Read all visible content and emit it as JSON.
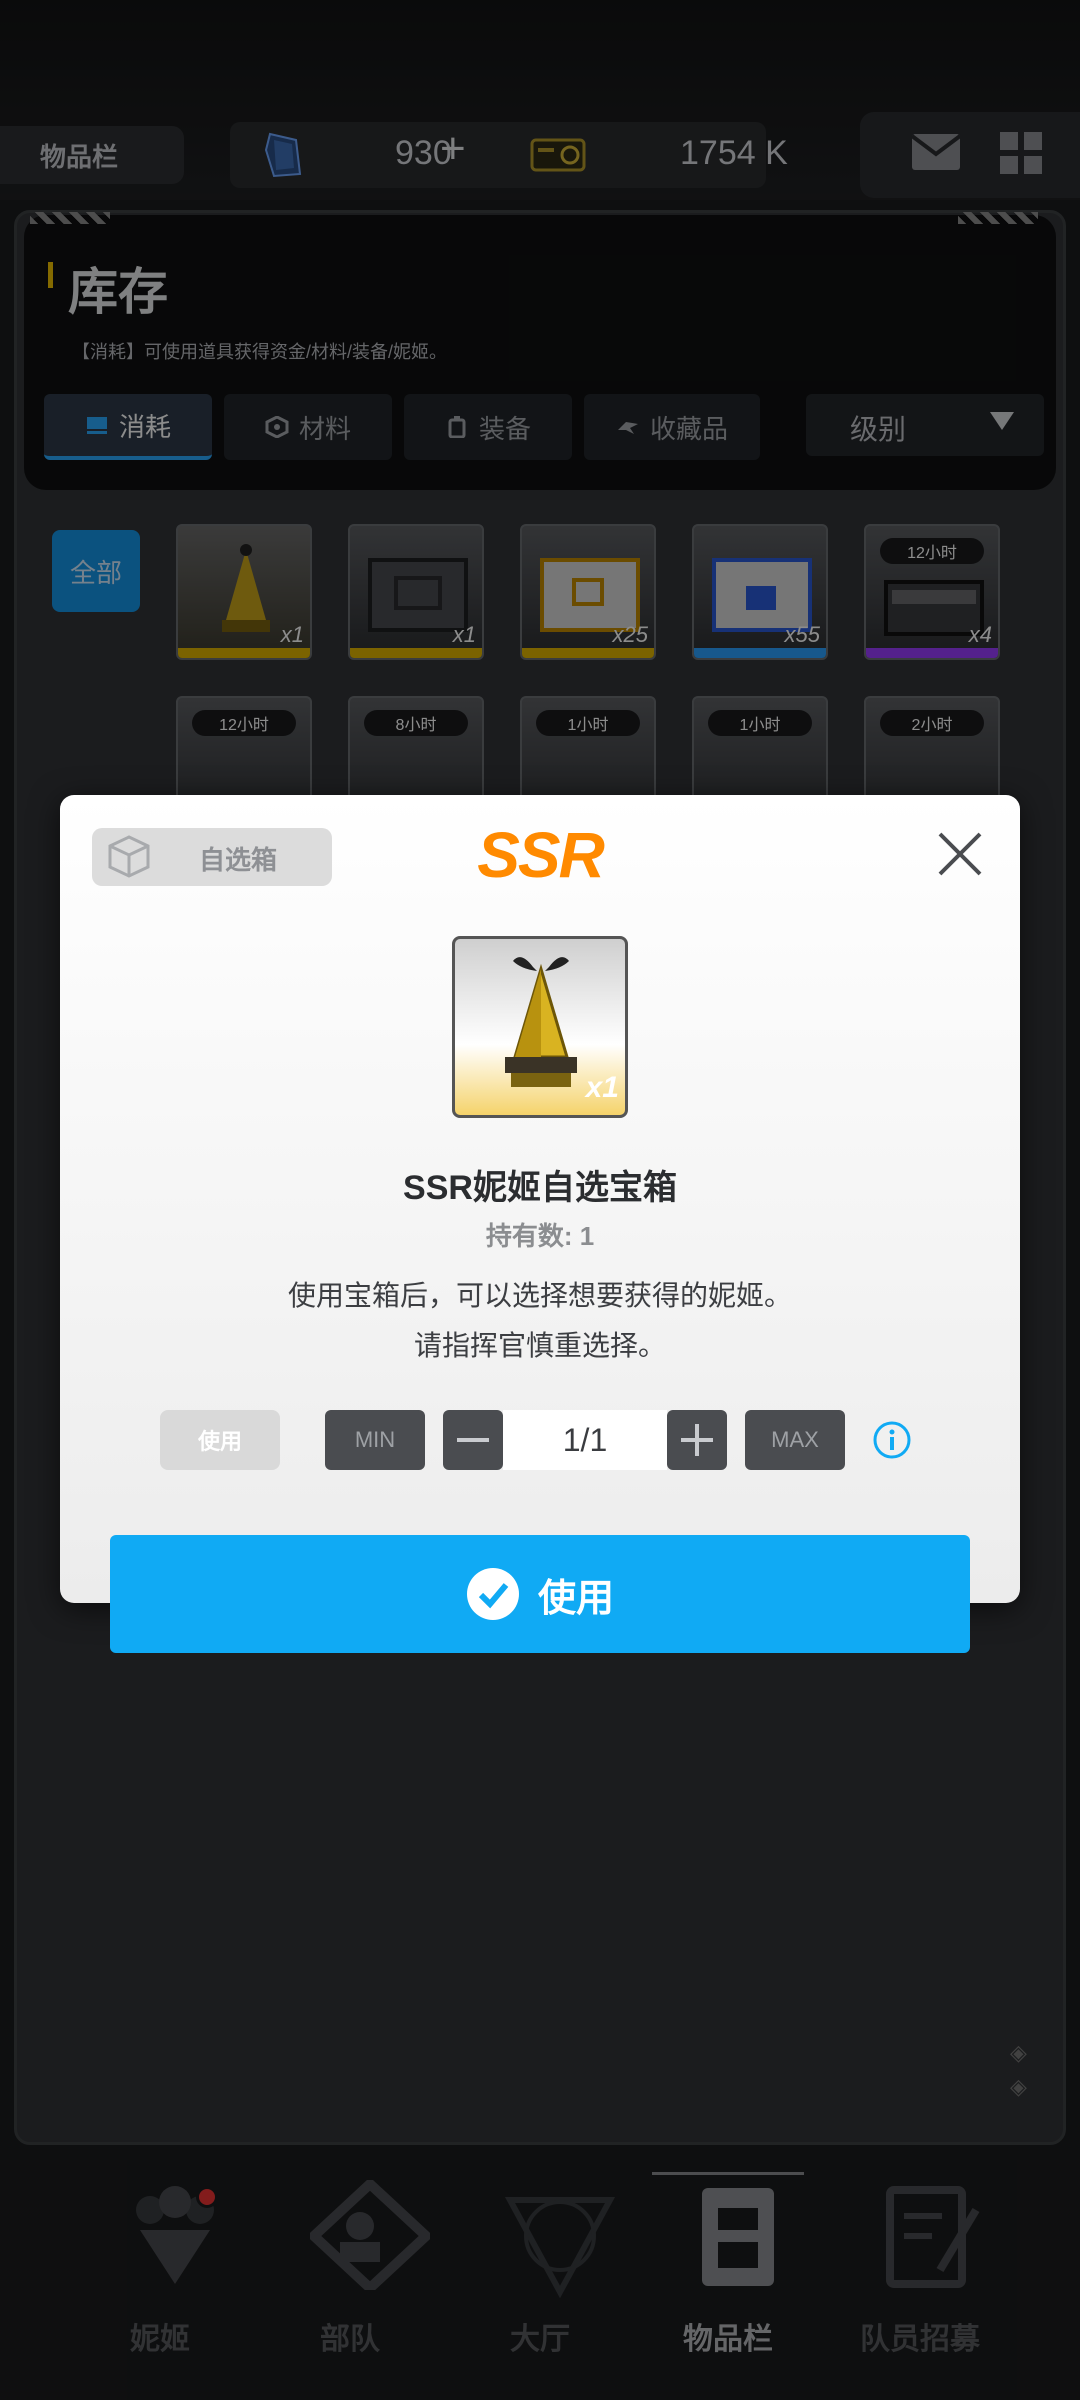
{
  "topbar": {
    "tab_label": "物品栏",
    "gems": "930",
    "plus": "+",
    "credits": "1754 K",
    "icons": [
      "gem-icon",
      "credit-icon",
      "mail-icon",
      "grid-icon"
    ]
  },
  "inventory": {
    "title": "库存",
    "subtitle": "【消耗】可使用道具获得资金/材料/装备/妮姬。",
    "tabs": [
      {
        "label": "消耗",
        "icon": "consumable-icon",
        "active": true
      },
      {
        "label": "材料",
        "icon": "material-icon",
        "active": false
      },
      {
        "label": "装备",
        "icon": "equipment-icon",
        "active": false
      },
      {
        "label": "收藏品",
        "icon": "collection-icon",
        "active": false
      }
    ],
    "sort_label": "级别",
    "filter_all": "全部",
    "items_row1": [
      {
        "count": "x1",
        "rarity_color": "#e0b400"
      },
      {
        "count": "x1",
        "rarity_color": "#e0b400"
      },
      {
        "count": "x25",
        "rarity_color": "#e0b400"
      },
      {
        "count": "x55",
        "rarity_color": "#2aa0ff"
      },
      {
        "count": "x4",
        "rarity_color": "#9a3cff",
        "timer": "12小时"
      }
    ],
    "items_row2": [
      {
        "timer": "12小时"
      },
      {
        "timer": "8小时"
      },
      {
        "timer": "1小时"
      },
      {
        "timer": "1小时"
      },
      {
        "timer": "2小时"
      }
    ]
  },
  "modal": {
    "tag": "自选箱",
    "rarity": "SSR",
    "item_count": "x1",
    "item_name": "SSR妮姬自选宝箱",
    "owned": "持有数: 1",
    "description_line1": "使用宝箱后，可以选择想要获得的妮姬。",
    "description_line2": "请指挥官慎重选择。",
    "use_small_label": "使用",
    "min_label": "MIN",
    "quantity": "1/1",
    "max_label": "MAX",
    "use_button_label": "使用",
    "accent_color": "#10aaf4",
    "rarity_color": "#ff8a00"
  },
  "nav": {
    "items": [
      {
        "label": "妮姬",
        "icon": "nikke-icon"
      },
      {
        "label": "部队",
        "icon": "squad-icon"
      },
      {
        "label": "大厅",
        "icon": "lobby-icon"
      },
      {
        "label": "物品栏",
        "icon": "inventory-icon",
        "active": true
      },
      {
        "label": "队员招募",
        "icon": "recruit-icon"
      }
    ]
  }
}
